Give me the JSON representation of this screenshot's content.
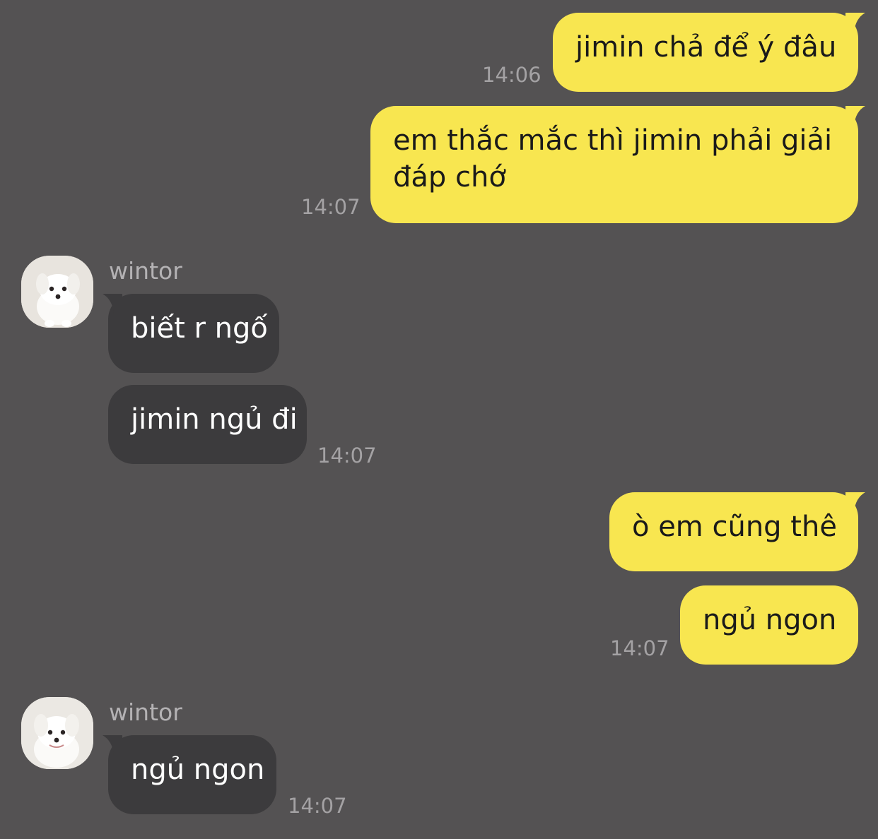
{
  "colors": {
    "background": "#545253",
    "outgoing_bubble": "#f8e650",
    "incoming_bubble": "#3c3b3d",
    "timestamp": "#a4a2a4"
  },
  "messages": [
    {
      "direction": "outgoing",
      "text": "jimin chả để ý đâu",
      "time": "14:06"
    },
    {
      "direction": "outgoing",
      "text": "em thắc mắc thì jimin phải giải đáp chớ",
      "time": "14:07"
    },
    {
      "direction": "incoming",
      "sender": "wintor",
      "avatar_icon": "white-puppy-avatar-icon",
      "text": "biết r ngố"
    },
    {
      "direction": "incoming",
      "text": "jimin ngủ đi",
      "time": "14:07"
    },
    {
      "direction": "outgoing",
      "text": "ò em cũng thê"
    },
    {
      "direction": "outgoing",
      "text": "ngủ ngon",
      "time": "14:07"
    },
    {
      "direction": "incoming",
      "sender": "wintor",
      "avatar_icon": "white-puppy-avatar-icon",
      "text": "ngủ ngon",
      "time": "14:07"
    }
  ]
}
